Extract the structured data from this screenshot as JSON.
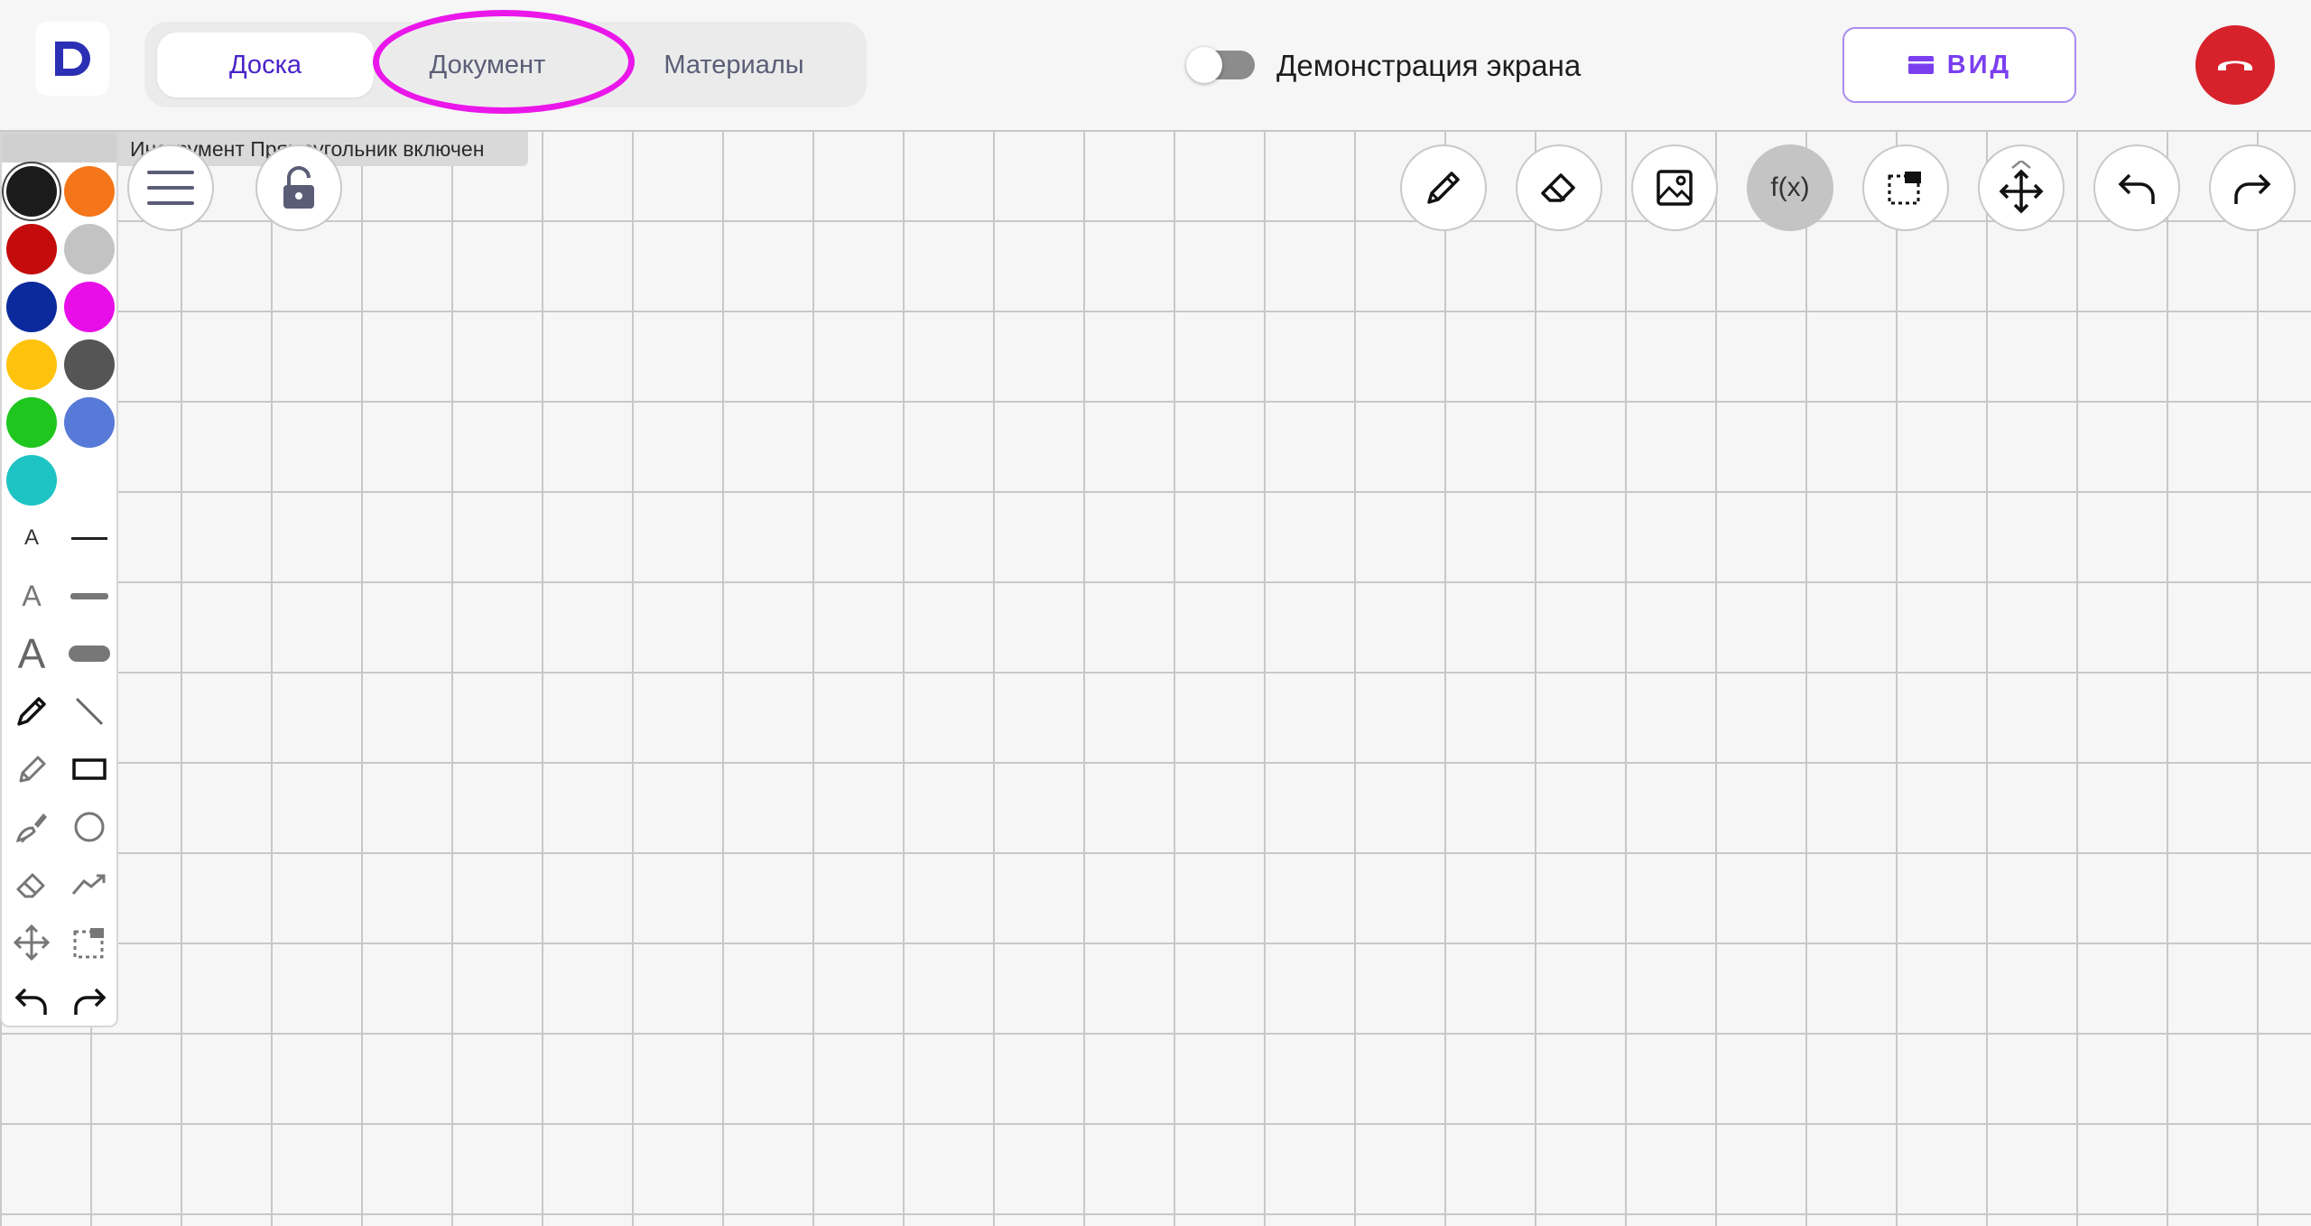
{
  "app": {
    "logo_letter": "D"
  },
  "tabs": [
    {
      "label": "Доска",
      "active": true
    },
    {
      "label": "Документ",
      "active": false
    },
    {
      "label": "Материалы",
      "active": false
    }
  ],
  "screen_share": {
    "label": "Демонстрация экрана",
    "enabled": false
  },
  "view_button": {
    "label": "ВИД",
    "icon": "view-icon"
  },
  "end_call": {
    "icon": "hang-up-icon",
    "color": "#d7222c"
  },
  "status_tip": "Инструмент Прямоугольник включен",
  "colors": {
    "accent": "#4a23c9",
    "highlight": "#ea16ea",
    "swatches": [
      "#1b1b1b",
      "#f5761a",
      "#c40b0b",
      "#c3c3c3",
      "#0b2a9c",
      "#e80ee8",
      "#ffc20d",
      "#555555",
      "#1ec61e",
      "#5779d8",
      "#1ec3c3"
    ]
  },
  "palette_tools": {
    "font_sizes": [
      "A",
      "A",
      "A"
    ],
    "line_widths": [
      "thin",
      "medium",
      "thick"
    ],
    "tools": [
      "pen",
      "line",
      "marker",
      "rectangle",
      "brush",
      "circle",
      "eraser",
      "trend-line",
      "move",
      "select",
      "undo",
      "redo"
    ]
  },
  "toolbar": {
    "left": [
      "menu-icon",
      "lock-icon"
    ],
    "right": [
      {
        "icon": "pencil-icon"
      },
      {
        "icon": "eraser-icon"
      },
      {
        "icon": "image-icon"
      },
      {
        "icon": "formula-icon",
        "label": "f(x)",
        "active": true
      },
      {
        "icon": "select-area-icon"
      },
      {
        "icon": "move-icon"
      },
      {
        "icon": "undo-icon"
      },
      {
        "icon": "redo-icon"
      }
    ]
  }
}
